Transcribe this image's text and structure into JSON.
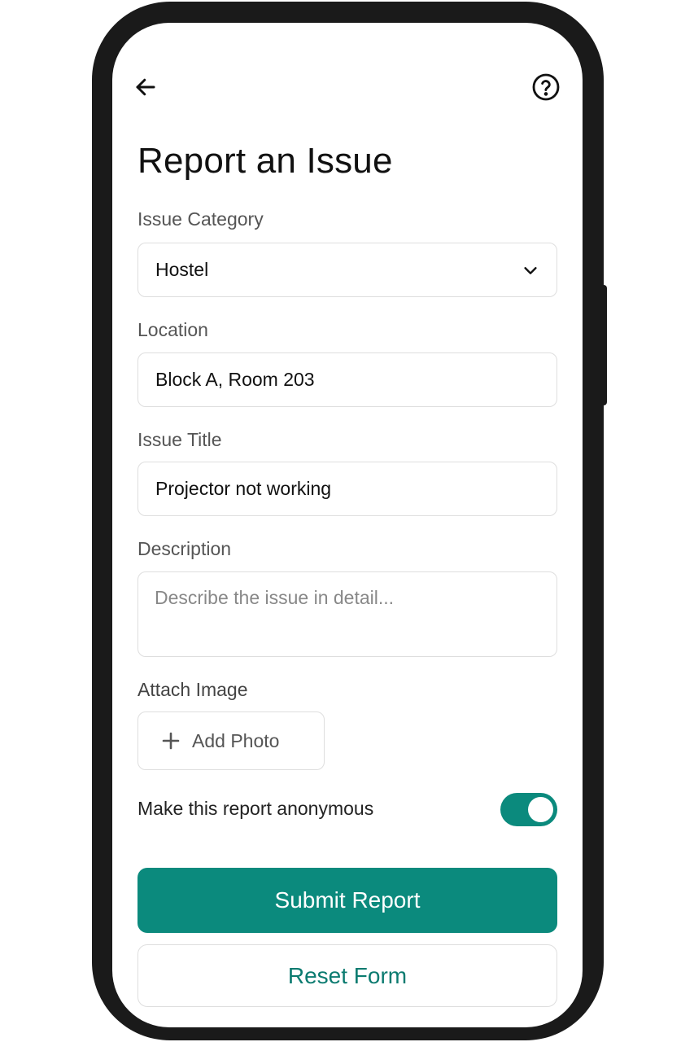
{
  "header": {
    "back_icon": "arrow-left-icon",
    "help_icon": "help-circle-icon",
    "title": "Report an Issue"
  },
  "form": {
    "category": {
      "label": "Issue Category",
      "value": "Hostel",
      "icon": "chevron-down-icon"
    },
    "location": {
      "label": "Location",
      "value": "Block A, Room 203"
    },
    "issue_title": {
      "label": "Issue Title",
      "value": "Projector not working"
    },
    "description": {
      "label": "Description",
      "value": "",
      "placeholder": "Describe the issue in detail..."
    },
    "attach": {
      "label": "Attach Image",
      "button_label": "Add Photo",
      "icon": "plus-icon"
    },
    "anonymous": {
      "label": "Make this report anonymous",
      "enabled": true
    }
  },
  "actions": {
    "submit_label": "Submit Report",
    "reset_label": "Reset Form"
  },
  "colors": {
    "accent": "#0b8a7d",
    "accent_text": "#0b7b70",
    "frame": "#1a1a1a",
    "border": "#dedede"
  }
}
